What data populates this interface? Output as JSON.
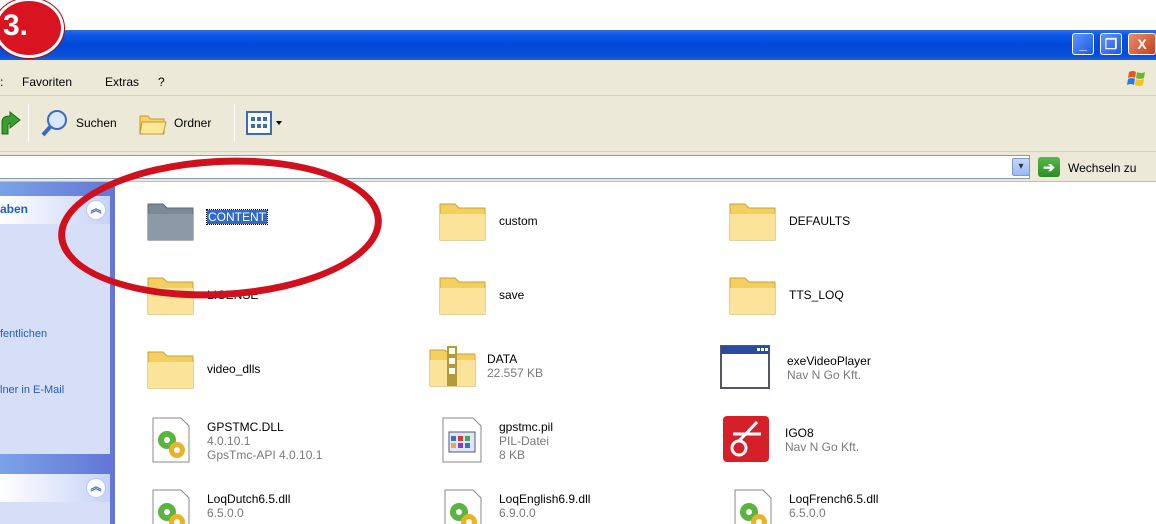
{
  "step_badge": "3.",
  "titlebar": {
    "minimize": "_",
    "maximize": "❐",
    "close": "X"
  },
  "menubar": {
    "items": [
      ":",
      "Favoriten",
      "Extras",
      "?"
    ]
  },
  "toolbar": {
    "search_label": "Suchen",
    "folders_label": "Ordner"
  },
  "addressbar": {
    "go_label": "Wechseln zu",
    "dropdown": "▾",
    "go_arrow": "➔"
  },
  "sidebar": {
    "panel1_title": "aben",
    "links": [
      "fentlichen",
      "lner in E-Mail"
    ],
    "collapse_glyph": "︽"
  },
  "files": [
    {
      "name": "CONTENT",
      "type": "folder",
      "selected": true,
      "meta": []
    },
    {
      "name": "custom",
      "type": "folder",
      "meta": []
    },
    {
      "name": "DEFAULTS",
      "type": "folder",
      "meta": []
    },
    {
      "name": "LICENSE",
      "type": "folder",
      "meta": []
    },
    {
      "name": "save",
      "type": "folder",
      "meta": []
    },
    {
      "name": "TTS_LOQ",
      "type": "folder",
      "meta": []
    },
    {
      "name": "video_dlls",
      "type": "folder",
      "meta": []
    },
    {
      "name": "DATA",
      "type": "zip",
      "meta": [
        "22.557 KB"
      ]
    },
    {
      "name": "exeVideoPlayer",
      "type": "exe",
      "meta": [
        "Nav N Go Kft."
      ]
    },
    {
      "name": "GPSTMC.DLL",
      "type": "dll",
      "meta": [
        "4.0.10.1",
        "GpsTmc-API 4.0.10.1"
      ]
    },
    {
      "name": "gpstmc.pil",
      "type": "pil",
      "meta": [
        "PIL-Datei",
        "8 KB"
      ]
    },
    {
      "name": "IGO8",
      "type": "igo",
      "meta": [
        "Nav N Go Kft."
      ]
    },
    {
      "name": "LoqDutch6.5.dll",
      "type": "dll",
      "meta": [
        "6.5.0.0"
      ]
    },
    {
      "name": "LoqEnglish6.9.dll",
      "type": "dll",
      "meta": [
        "6.9.0.0"
      ]
    },
    {
      "name": "LoqFrench6.5.dll",
      "type": "dll",
      "meta": [
        "6.5.0.0"
      ]
    }
  ],
  "colors": {
    "annotation": "#d0101c",
    "selection": "#316ac5",
    "titlebar": "#0048d8"
  }
}
